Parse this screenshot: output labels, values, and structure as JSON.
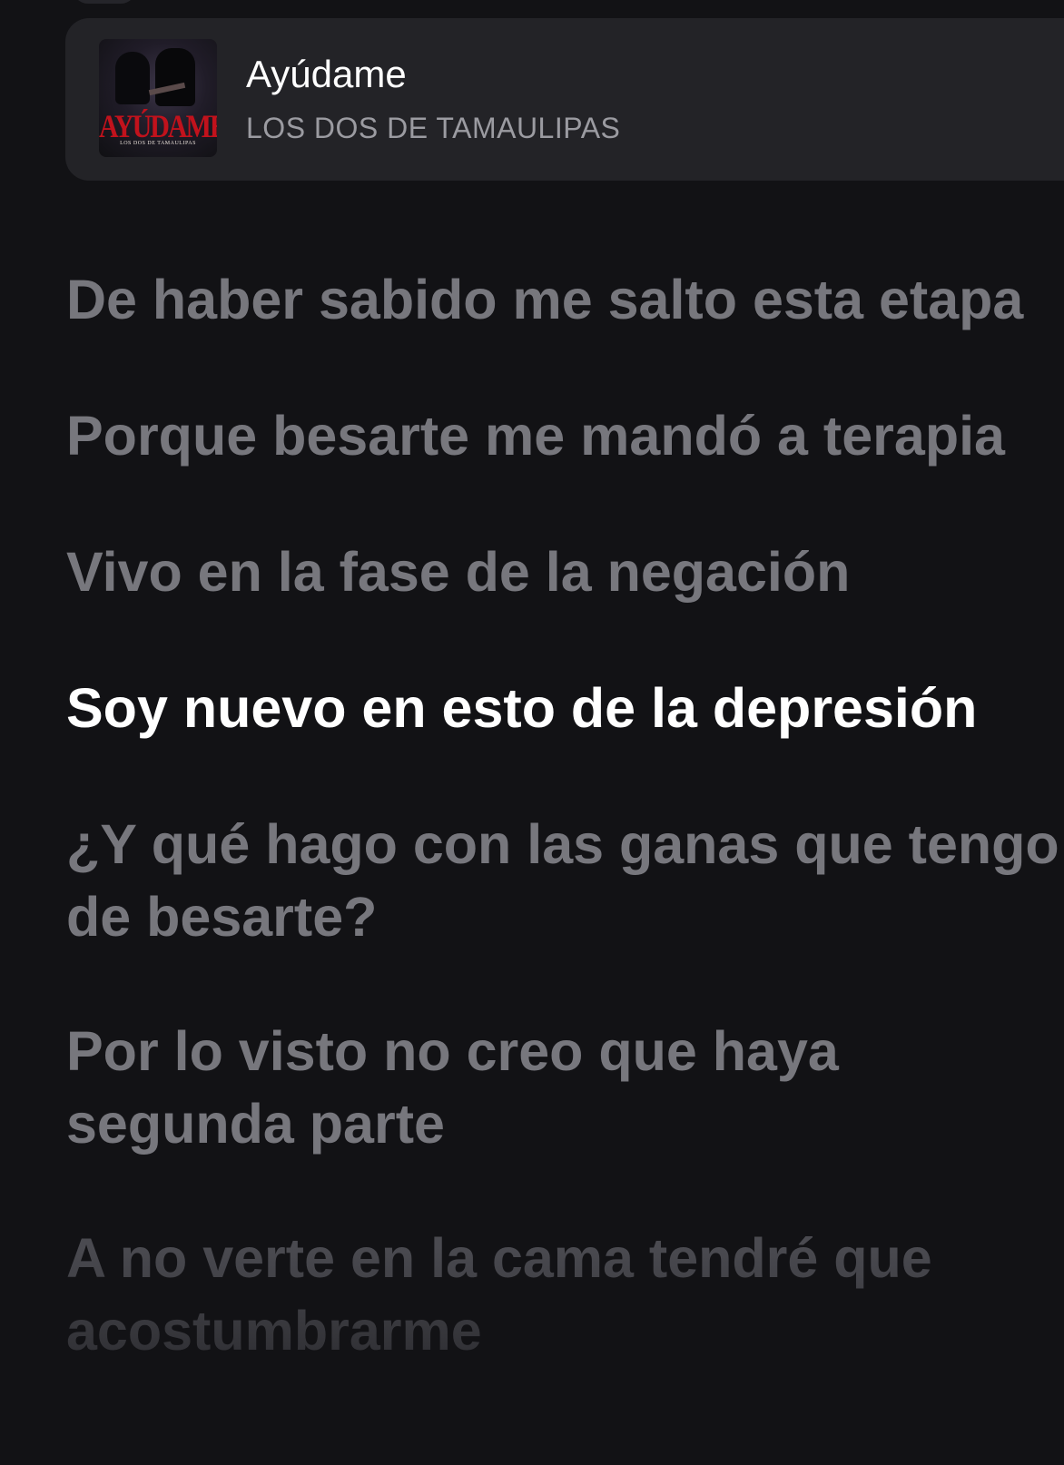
{
  "now_playing": {
    "title": "Ayúdame",
    "artist": "LOS DOS DE TAMAULIPAS",
    "artwork": {
      "icon": "album-art",
      "text": "AYÚDAME",
      "subtext": "LOS DOS DE TAMAULIPAS"
    }
  },
  "lyrics": [
    {
      "text": "De haber sabido me salto esta etapa",
      "state": "past"
    },
    {
      "text": "Porque besarte me mandó a terapia",
      "state": "past"
    },
    {
      "text": "Vivo en la fase de la negación",
      "state": "past"
    },
    {
      "text": "Soy nuevo en esto de la depresión",
      "state": "active"
    },
    {
      "text": "¿Y qué hago con las ganas que tengo",
      "text2": "de besarte?",
      "state": "upcoming"
    },
    {
      "text": "Por lo visto no creo que haya",
      "text2": "segunda parte",
      "state": "upcoming"
    },
    {
      "text": "A no verte en la cama tendré que",
      "text2": "acostumbrarme",
      "state": "faded"
    }
  ],
  "colors": {
    "background": "#121215",
    "card": "#232327",
    "active_lyric": "#ffffff",
    "inactive_lyric": "#77777d",
    "artist_text": "#9b9ba1"
  }
}
